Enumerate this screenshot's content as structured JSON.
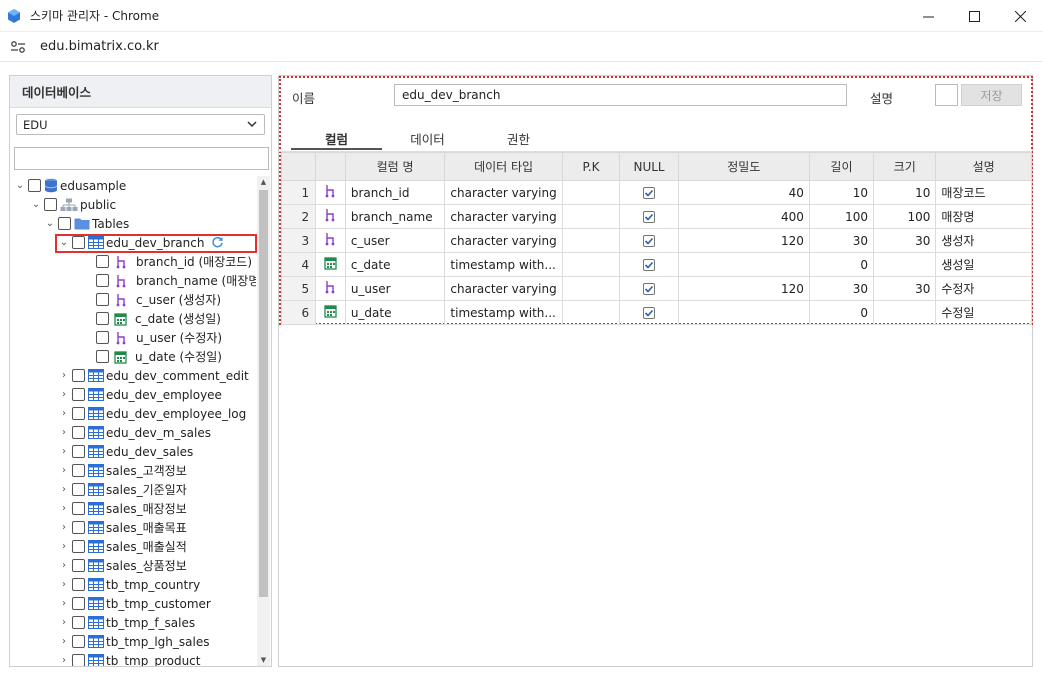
{
  "window": {
    "title": "스키마 관리자 - Chrome",
    "url": "edu.bimatrix.co.kr"
  },
  "left_panel": {
    "header": "데이터베이스",
    "db_select": "EDU",
    "tree_search_value": "",
    "tree": {
      "db": "edusample",
      "schema": "public",
      "tables_folder": "Tables",
      "selected_table": "edu_dev_branch",
      "columns": [
        {
          "label": "branch_id (매장코드)",
          "icon": "key-icon"
        },
        {
          "label": "branch_name (매장명)",
          "icon": "key-icon"
        },
        {
          "label": "c_user (생성자)",
          "icon": "key-icon"
        },
        {
          "label": "c_date (생성일)",
          "icon": "calendar-icon"
        },
        {
          "label": "u_user (수정자)",
          "icon": "key-icon"
        },
        {
          "label": "u_date (수정일)",
          "icon": "calendar-icon"
        }
      ],
      "other_tables": [
        "edu_dev_comment_edit",
        "edu_dev_employee",
        "edu_dev_employee_log",
        "edu_dev_m_sales",
        "edu_dev_sales",
        "sales_고객정보",
        "sales_기준일자",
        "sales_매장정보",
        "sales_매출목표",
        "sales_매출실적",
        "sales_상품정보",
        "tb_tmp_country",
        "tb_tmp_customer",
        "tb_tmp_f_sales",
        "tb_tmp_lgh_sales",
        "tb_tmp_product"
      ]
    }
  },
  "right_panel": {
    "name_label": "이름",
    "name_value": "edu_dev_branch",
    "desc_label": "설명",
    "desc_value": "",
    "save_label": "저장",
    "tabs": [
      "컬럼",
      "데이터",
      "권한"
    ],
    "active_tab": "컬럼",
    "grid": {
      "headers": [
        "컬럼 명",
        "데이터 타입",
        "P.K",
        "NULL",
        "정밀도",
        "길이",
        "크기",
        "설명"
      ],
      "rows": [
        {
          "n": "1",
          "icon": "key-icon",
          "name": "branch_id",
          "type": "character varying",
          "pk": "",
          "null": true,
          "precision": "40",
          "length": "10",
          "size": "10",
          "desc": "매장코드"
        },
        {
          "n": "2",
          "icon": "key-icon",
          "name": "branch_name",
          "type": "character varying",
          "pk": "",
          "null": true,
          "precision": "400",
          "length": "100",
          "size": "100",
          "desc": "매장명"
        },
        {
          "n": "3",
          "icon": "key-icon",
          "name": "c_user",
          "type": "character varying",
          "pk": "",
          "null": true,
          "precision": "120",
          "length": "30",
          "size": "30",
          "desc": "생성자"
        },
        {
          "n": "4",
          "icon": "calendar-icon",
          "name": "c_date",
          "type": "timestamp with...",
          "pk": "",
          "null": true,
          "precision": "",
          "length": "0",
          "size": "",
          "desc": "생성일"
        },
        {
          "n": "5",
          "icon": "key-icon",
          "name": "u_user",
          "type": "character varying",
          "pk": "",
          "null": true,
          "precision": "120",
          "length": "30",
          "size": "30",
          "desc": "수정자"
        },
        {
          "n": "6",
          "icon": "calendar-icon",
          "name": "u_date",
          "type": "timestamp with...",
          "pk": "",
          "null": true,
          "precision": "",
          "length": "0",
          "size": "",
          "desc": "수정일"
        }
      ]
    }
  },
  "colors": {
    "selection_outline": "#e03030",
    "key_icon": "#8a3fd1",
    "calendar_icon": "#1f8a4c",
    "table_icon": "#2b6fd6",
    "folder_icon": "#5b8fe0"
  }
}
